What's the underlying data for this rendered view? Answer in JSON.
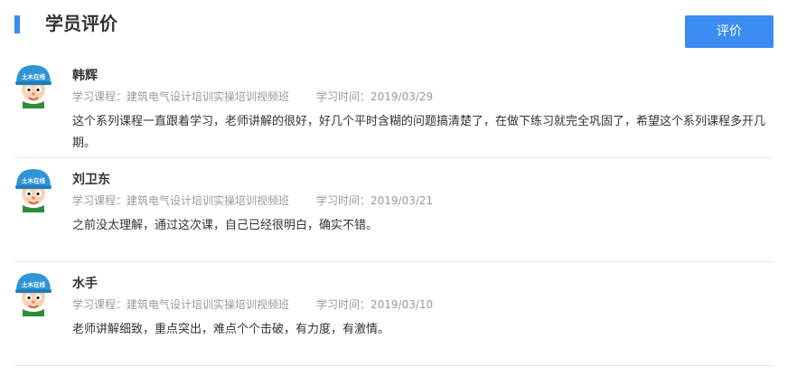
{
  "header": {
    "title": "学员评价",
    "review_button_label": "评价"
  },
  "reviews": [
    {
      "name": "韩辉",
      "course": "学习课程：建筑电气设计培训实操培训视频班",
      "time": "学习时间：2019/03/29",
      "comment": "这个系列课程一直跟着学习，老师讲解的很好，好几个平时含糊的问题搞清楚了，在做下练习就完全巩固了，希望这个系列课程多开几期。"
    },
    {
      "name": "刘卫东",
      "course": "学习课程：建筑电气设计培训实操培训视频班",
      "time": "学习时间：2019/03/21",
      "comment": "之前没太理解，通过这次课，自己已经很明白，确实不错。"
    },
    {
      "name": "水手",
      "course": "学习课程：建筑电气设计培训实操培训视频班",
      "time": "学习时间：2019/03/10",
      "comment": "老师讲解细致，重点突出，难点个个击破，有力度，有激情。"
    }
  ],
  "avatar": {
    "icon": "cartoon-worker-helmet-avatar",
    "helmet_text": "土木在线",
    "helmet_color": "#2f95d6"
  },
  "colors": {
    "accent": "#3b8cf0",
    "meta_text": "#9a9a9a",
    "body_text": "#333333",
    "divider": "#e5e5e5"
  }
}
